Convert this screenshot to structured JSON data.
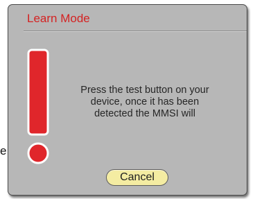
{
  "background": {
    "fragment_text": "e"
  },
  "dialog": {
    "title": "Learn Mode",
    "title_color": "#d42222",
    "background_color": "#b7b7b7",
    "icon": "exclamation-icon",
    "icon_color": "#e0262b",
    "message_lines": [
      "Press the test button on your",
      "device, once it has been",
      "detected the MMSI will"
    ],
    "cancel_label": "Cancel",
    "cancel_color": "#f4eca2"
  }
}
